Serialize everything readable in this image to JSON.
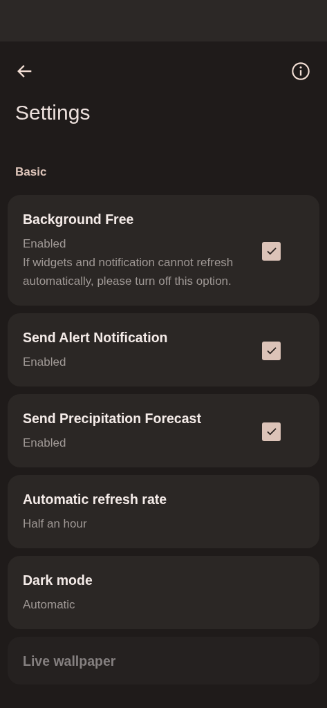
{
  "title": "Settings",
  "section": "Basic",
  "items": [
    {
      "kind": "checkbox",
      "title": "Background Free",
      "summary": "Enabled",
      "description": "If widgets and notification cannot refresh automatically, please turn off this option.",
      "checked": true,
      "disabled": false
    },
    {
      "kind": "checkbox",
      "title": "Send Alert Notification",
      "summary": "Enabled",
      "checked": true,
      "disabled": false
    },
    {
      "kind": "checkbox",
      "title": "Send Precipitation Forecast",
      "summary": "Enabled",
      "checked": true,
      "disabled": false
    },
    {
      "kind": "text",
      "title": "Automatic refresh rate",
      "summary": "Half an hour",
      "disabled": false
    },
    {
      "kind": "text",
      "title": "Dark mode",
      "summary": "Automatic",
      "disabled": false
    },
    {
      "kind": "text",
      "title": "Live wallpaper",
      "disabled": true
    }
  ]
}
